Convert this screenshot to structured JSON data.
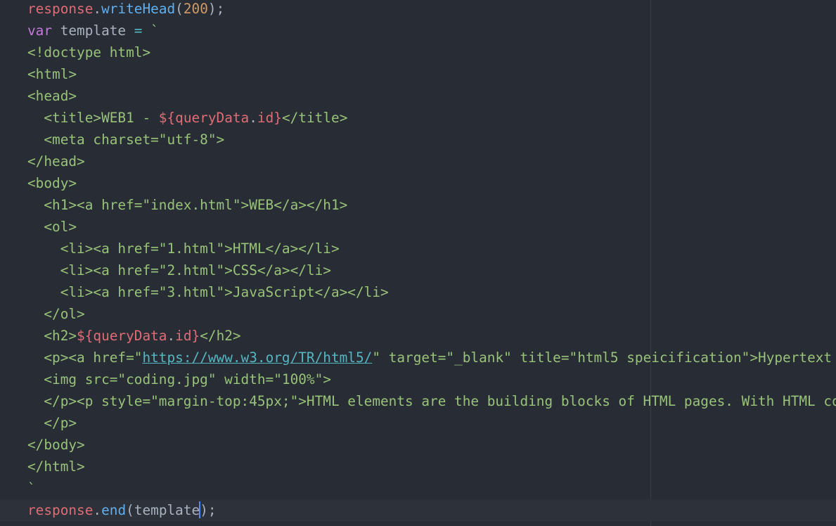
{
  "editor": {
    "lines": [
      [
        {
          "t": "response",
          "c": "var"
        },
        {
          "t": ".",
          "c": "pl"
        },
        {
          "t": "writeHead",
          "c": "fn"
        },
        {
          "t": "(",
          "c": "pl"
        },
        {
          "t": "200",
          "c": "num"
        },
        {
          "t": ");",
          "c": "pl"
        }
      ],
      [
        {
          "t": "var",
          "c": "kw"
        },
        {
          "t": " template ",
          "c": "pl"
        },
        {
          "t": "=",
          "c": "op"
        },
        {
          "t": " `",
          "c": "str"
        }
      ],
      [
        {
          "t": "<!doctype html>",
          "c": "str"
        }
      ],
      [
        {
          "t": "<html>",
          "c": "str"
        }
      ],
      [
        {
          "t": "<head>",
          "c": "str"
        }
      ],
      [
        {
          "t": "  <title>WEB1 - ",
          "c": "str"
        },
        {
          "t": "${",
          "c": "ph"
        },
        {
          "t": "queryData",
          "c": "var"
        },
        {
          "t": ".",
          "c": "pl"
        },
        {
          "t": "id",
          "c": "var"
        },
        {
          "t": "}",
          "c": "ph"
        },
        {
          "t": "</title>",
          "c": "str"
        }
      ],
      [
        {
          "t": "  <meta charset=\"utf-8\">",
          "c": "str"
        }
      ],
      [
        {
          "t": "</head>",
          "c": "str"
        }
      ],
      [
        {
          "t": "<body>",
          "c": "str"
        }
      ],
      [
        {
          "t": "  <h1><a href=\"index.html\">WEB</a></h1>",
          "c": "str"
        }
      ],
      [
        {
          "t": "  <ol>",
          "c": "str"
        }
      ],
      [
        {
          "t": "    <li><a href=\"1.html\">HTML</a></li>",
          "c": "str"
        }
      ],
      [
        {
          "t": "    <li><a href=\"2.html\">CSS</a></li>",
          "c": "str"
        }
      ],
      [
        {
          "t": "    <li><a href=\"3.html\">JavaScript</a></li>",
          "c": "str"
        }
      ],
      [
        {
          "t": "  </ol>",
          "c": "str"
        }
      ],
      [
        {
          "t": "  <h2>",
          "c": "str"
        },
        {
          "t": "${",
          "c": "ph"
        },
        {
          "t": "queryData",
          "c": "var"
        },
        {
          "t": ".",
          "c": "pl"
        },
        {
          "t": "id",
          "c": "var"
        },
        {
          "t": "}",
          "c": "ph"
        },
        {
          "t": "</h2>",
          "c": "str"
        }
      ],
      [
        {
          "t": "  <p><a href=\"",
          "c": "str"
        },
        {
          "t": "https://www.w3.org/TR/html5/",
          "c": "url"
        },
        {
          "t": "\" target=\"_blank\" title=\"html5 speicification\">Hypertext",
          "c": "str"
        }
      ],
      [
        {
          "t": "  <img src=\"coding.jpg\" width=\"100%\">",
          "c": "str"
        }
      ],
      [
        {
          "t": "  </p><p style=\"margin-top:45px;\">HTML elements are the building blocks of HTML pages. With HTML co",
          "c": "str"
        }
      ],
      [
        {
          "t": "  </p>",
          "c": "str"
        }
      ],
      [
        {
          "t": "</body>",
          "c": "str"
        }
      ],
      [
        {
          "t": "</html>",
          "c": "str"
        }
      ],
      [
        {
          "t": "`",
          "c": "str"
        }
      ],
      [
        {
          "t": "response",
          "c": "var"
        },
        {
          "t": ".",
          "c": "pl"
        },
        {
          "t": "end",
          "c": "fn"
        },
        {
          "t": "(",
          "c": "pl"
        },
        {
          "t": "template",
          "c": "pl"
        },
        {
          "t": ");",
          "c": "pl"
        }
      ]
    ],
    "cursor": {
      "line": 23,
      "segment": 4,
      "offset": 8
    },
    "active_line": 23,
    "colors": {
      "background": "#282c34",
      "string": "#98c379",
      "variable": "#e06c75",
      "function": "#61afef",
      "keyword": "#c678dd",
      "number": "#d19a66",
      "cursor": "#528bff"
    }
  }
}
